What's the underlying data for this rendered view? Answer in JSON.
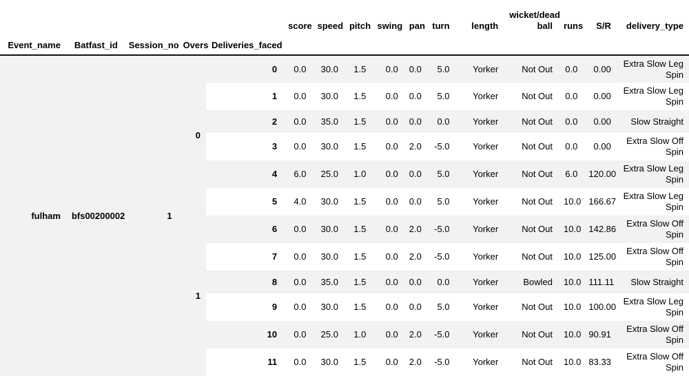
{
  "table": {
    "type": "pandas-dataframe-multiindex",
    "index_columns": [
      "Event_name",
      "Batfast_id",
      "Session_no",
      "Overs",
      "Deliveries_faced"
    ],
    "value_columns": [
      "score",
      "speed",
      "pitch",
      "swing",
      "pan",
      "turn",
      "length",
      "wicket/dead ball",
      "runs",
      "S/R",
      "delivery_type"
    ],
    "index_values": {
      "Event_name": "fulham",
      "Batfast_id": "bfs00200002",
      "Session_no": "1",
      "Overs_first": "0",
      "Overs_second": "1"
    },
    "rows": [
      {
        "deliveries_faced": "0",
        "score": "0.0",
        "speed": "30.0",
        "pitch": "1.5",
        "swing": "0.0",
        "pan": "0.0",
        "turn": "5.0",
        "length": "Yorker",
        "wicket": "Not Out",
        "runs": "0.0",
        "sr": "0.00",
        "delivery_type": "Extra Slow Leg Spin"
      },
      {
        "deliveries_faced": "1",
        "score": "0.0",
        "speed": "30.0",
        "pitch": "1.5",
        "swing": "0.0",
        "pan": "0.0",
        "turn": "5.0",
        "length": "Yorker",
        "wicket": "Not Out",
        "runs": "0.0",
        "sr": "0.00",
        "delivery_type": "Extra Slow Leg Spin"
      },
      {
        "deliveries_faced": "2",
        "score": "0.0",
        "speed": "35.0",
        "pitch": "1.5",
        "swing": "0.0",
        "pan": "0.0",
        "turn": "0.0",
        "length": "Yorker",
        "wicket": "Not Out",
        "runs": "0.0",
        "sr": "0.00",
        "delivery_type": "Slow Straight"
      },
      {
        "deliveries_faced": "3",
        "score": "0.0",
        "speed": "30.0",
        "pitch": "1.5",
        "swing": "0.0",
        "pan": "2.0",
        "turn": "-5.0",
        "length": "Yorker",
        "wicket": "Not Out",
        "runs": "0.0",
        "sr": "0.00",
        "delivery_type": "Extra Slow Off Spin"
      },
      {
        "deliveries_faced": "4",
        "score": "6.0",
        "speed": "25.0",
        "pitch": "1.0",
        "swing": "0.0",
        "pan": "0.0",
        "turn": "5.0",
        "length": "Yorker",
        "wicket": "Not Out",
        "runs": "6.0",
        "sr": "120.00",
        "delivery_type": "Extra Slow Leg Spin"
      },
      {
        "deliveries_faced": "5",
        "score": "4.0",
        "speed": "30.0",
        "pitch": "1.5",
        "swing": "0.0",
        "pan": "0.0",
        "turn": "5.0",
        "length": "Yorker",
        "wicket": "Not Out",
        "runs": "10.0",
        "sr": "166.67",
        "delivery_type": "Extra Slow Leg Spin"
      },
      {
        "deliveries_faced": "6",
        "score": "0.0",
        "speed": "30.0",
        "pitch": "1.5",
        "swing": "0.0",
        "pan": "2.0",
        "turn": "-5.0",
        "length": "Yorker",
        "wicket": "Not Out",
        "runs": "10.0",
        "sr": "142.86",
        "delivery_type": "Extra Slow Off Spin"
      },
      {
        "deliveries_faced": "7",
        "score": "0.0",
        "speed": "30.0",
        "pitch": "1.5",
        "swing": "0.0",
        "pan": "2.0",
        "turn": "-5.0",
        "length": "Yorker",
        "wicket": "Not Out",
        "runs": "10.0",
        "sr": "125.00",
        "delivery_type": "Extra Slow Off Spin"
      },
      {
        "deliveries_faced": "8",
        "score": "0.0",
        "speed": "35.0",
        "pitch": "1.5",
        "swing": "0.0",
        "pan": "0.0",
        "turn": "0.0",
        "length": "Yorker",
        "wicket": "Bowled",
        "runs": "10.0",
        "sr": "111.11",
        "delivery_type": "Slow Straight"
      },
      {
        "deliveries_faced": "9",
        "score": "0.0",
        "speed": "30.0",
        "pitch": "1.5",
        "swing": "0.0",
        "pan": "0.0",
        "turn": "5.0",
        "length": "Yorker",
        "wicket": "Not Out",
        "runs": "10.0",
        "sr": "100.00",
        "delivery_type": "Extra Slow Leg Spin"
      },
      {
        "deliveries_faced": "10",
        "score": "0.0",
        "speed": "25.0",
        "pitch": "1.0",
        "swing": "0.0",
        "pan": "2.0",
        "turn": "-5.0",
        "length": "Yorker",
        "wicket": "Not Out",
        "runs": "10.0",
        "sr": "90.91",
        "delivery_type": "Extra Slow Off Spin"
      },
      {
        "deliveries_faced": "11",
        "score": "0.0",
        "speed": "30.0",
        "pitch": "1.5",
        "swing": "0.0",
        "pan": "2.0",
        "turn": "-5.0",
        "length": "Yorker",
        "wicket": "Not Out",
        "runs": "10.0",
        "sr": "83.33",
        "delivery_type": "Extra Slow Off Spin"
      }
    ],
    "headers": {
      "event_name": "Event_name",
      "batfast_id": "Batfast_id",
      "session_no": "Session_no",
      "overs": "Overs",
      "deliveries_faced": "Deliveries_faced",
      "score": "score",
      "speed": "speed",
      "pitch": "pitch",
      "swing": "swing",
      "pan": "pan",
      "turn": "turn",
      "length": "length",
      "wicket": "wicket/dead ball",
      "runs": "runs",
      "sr": "S/R",
      "delivery_type": "delivery_type"
    },
    "colors": {
      "stripe": "#f2f2f2",
      "background": "#ffffff",
      "rule": "#111111",
      "text": "#000000"
    }
  }
}
